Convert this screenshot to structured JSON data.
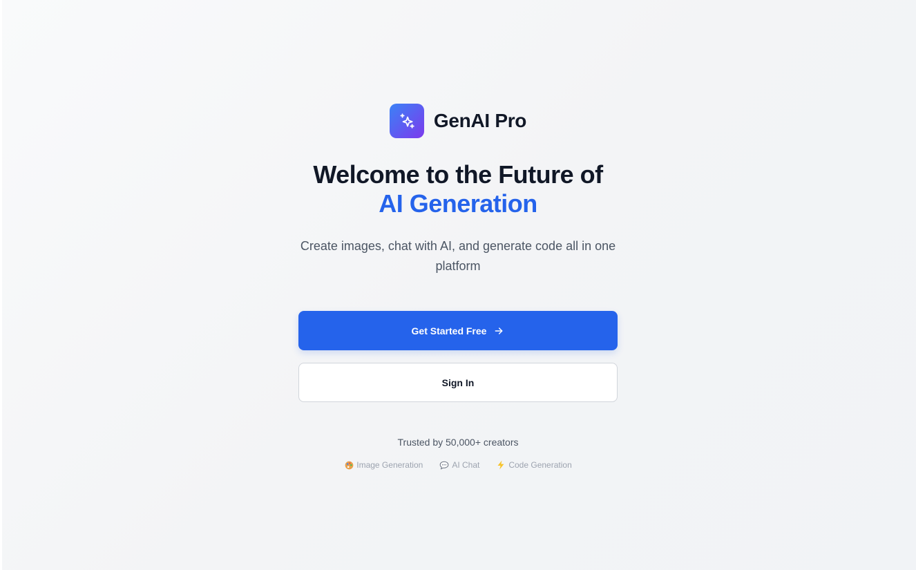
{
  "brand": {
    "name": "GenAI Pro",
    "logo_icon": "sparkles-icon",
    "logo_gradient": [
      "#3b82f6",
      "#7c3aed"
    ]
  },
  "hero": {
    "headline": "Welcome to the Future of",
    "headline_accent": "AI Generation",
    "subtitle": "Create images, chat with AI, and generate code all in one platform"
  },
  "actions": {
    "primary_label": "Get Started Free",
    "primary_icon": "arrow-right-icon",
    "secondary_label": "Sign In"
  },
  "footer": {
    "trusted_text": "Trusted by 50,000+ creators",
    "features": [
      {
        "icon": "palette-icon",
        "label": "Image Generation"
      },
      {
        "icon": "speech-bubble-icon",
        "label": "AI Chat"
      },
      {
        "icon": "lightning-icon",
        "label": "Code Generation"
      }
    ]
  },
  "colors": {
    "accent": "#2563eb",
    "heading": "#111827",
    "body_text": "#4b5563",
    "muted_text": "#9ca3af"
  }
}
